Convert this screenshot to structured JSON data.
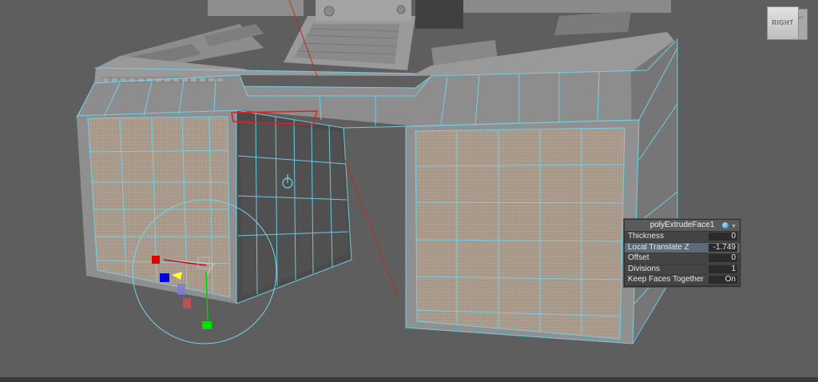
{
  "viewcube": {
    "face_label": "RIGHT",
    "side_label": "BK"
  },
  "panel": {
    "title": "polyExtrudeFace1",
    "rows": [
      {
        "label": "Thickness",
        "value": "0"
      },
      {
        "label": "Local Translate Z",
        "value": "-1.749"
      },
      {
        "label": "Offset",
        "value": "0"
      },
      {
        "label": "Divisions",
        "value": "1"
      },
      {
        "label": "Keep Faces Together",
        "value": "On"
      }
    ]
  },
  "colors": {
    "background": "#5e5e5e",
    "wireframe": "#6fd8f0",
    "face_fill": "#a89c8e",
    "selection": "#e02020",
    "manipulator_x": "#e00000",
    "manipulator_y": "#00d000",
    "manipulator_z": "#0000e0"
  },
  "icons": [
    "viewcube-icon",
    "pivot-icon",
    "move-manipulator-icon",
    "attribute-dot-icon"
  ]
}
